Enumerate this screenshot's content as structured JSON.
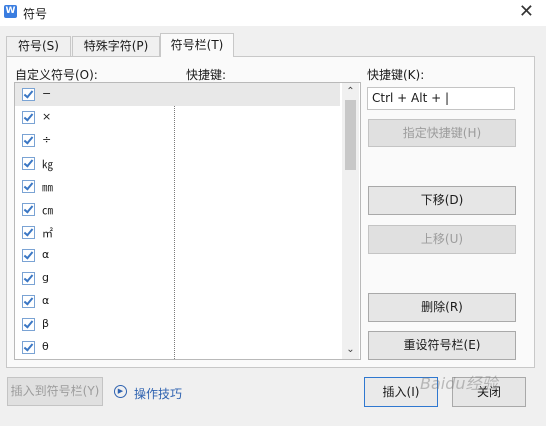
{
  "window": {
    "title": "符号",
    "app_icon_text": "W"
  },
  "tabs": [
    {
      "label": "符号(S)"
    },
    {
      "label": "特殊字符(P)"
    },
    {
      "label": "符号栏(T)"
    }
  ],
  "list": {
    "symbol_header": "自定义符号(O):",
    "shortcut_header": "快捷键:",
    "items": [
      "−",
      "×",
      "÷",
      "㎏",
      "㎜",
      "㎝",
      "㎡",
      "α",
      "g",
      "α",
      "β",
      "θ"
    ]
  },
  "shortcut": {
    "label": "快捷键(K):",
    "value": "Ctrl + Alt + |"
  },
  "buttons": {
    "assign": "指定快捷键(H)",
    "move_down": "下移(D)",
    "move_up": "上移(U)",
    "delete": "删除(R)",
    "reset": "重设符号栏(E)",
    "insert_to_bar": "插入到符号栏(Y)",
    "insert": "插入(I)",
    "cancel": "关闭"
  },
  "tips_link": "操作技巧",
  "watermark": "Baidu经验"
}
